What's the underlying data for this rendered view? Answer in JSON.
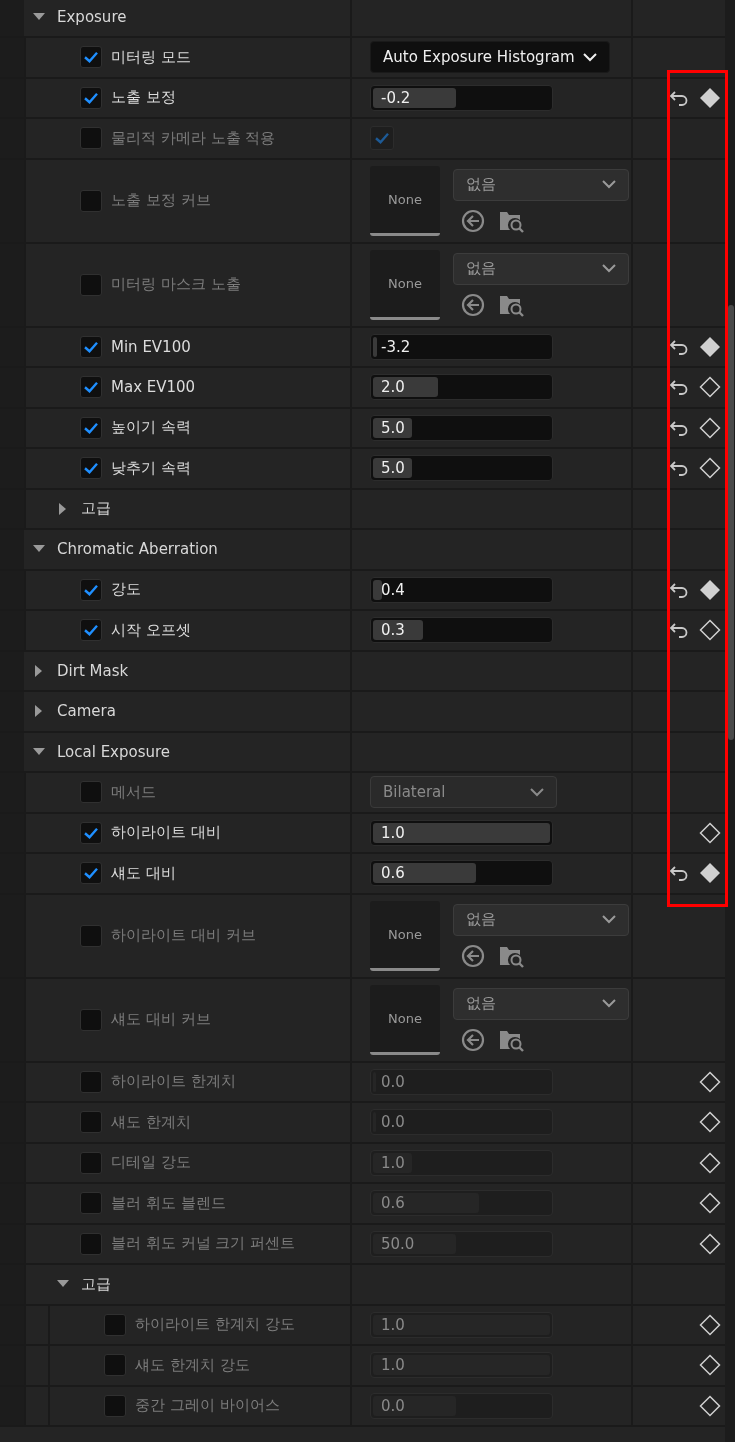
{
  "categories": [
    {
      "title": "Exposure",
      "expanded": true,
      "children": [
        {
          "kind": "property",
          "label": "미터링 모드",
          "checked": true,
          "reset": false,
          "animatable": false,
          "value": {
            "kind": "dropdown",
            "text": "Auto Exposure Histogram"
          }
        },
        {
          "kind": "property",
          "label": "노출 보정",
          "checked": true,
          "reset": true,
          "animatable": true,
          "keyed": true,
          "value": {
            "kind": "slider",
            "text": "-0.2",
            "level": 0.47
          }
        },
        {
          "kind": "property",
          "label": "물리적 카메라 노출 적용",
          "checked": false,
          "reset": false,
          "animatable": false,
          "value": {
            "kind": "checkbox",
            "checked": true
          }
        },
        {
          "kind": "property",
          "label": "노출 보정 커브",
          "checked": false,
          "reset": false,
          "animatable": false,
          "value": {
            "kind": "asset",
            "thumbnail": "None",
            "selection": "없음"
          }
        },
        {
          "kind": "property",
          "label": "미터링 마스크 노출",
          "checked": false,
          "reset": false,
          "animatable": false,
          "value": {
            "kind": "asset",
            "thumbnail": "None",
            "selection": "없음"
          }
        },
        {
          "kind": "property",
          "label": "Min EV100",
          "checked": true,
          "reset": true,
          "animatable": true,
          "keyed": true,
          "value": {
            "kind": "slider",
            "text": "-3.2",
            "level": 0.02
          }
        },
        {
          "kind": "property",
          "label": "Max EV100",
          "checked": true,
          "reset": true,
          "animatable": true,
          "keyed": false,
          "value": {
            "kind": "slider",
            "text": "2.0",
            "level": 0.37
          }
        },
        {
          "kind": "property",
          "label": "높이기 속력",
          "checked": true,
          "reset": true,
          "animatable": true,
          "keyed": false,
          "value": {
            "kind": "slider",
            "text": "5.0",
            "level": 0.22
          }
        },
        {
          "kind": "property",
          "label": "낮추기 속력",
          "checked": true,
          "reset": true,
          "animatable": true,
          "keyed": false,
          "value": {
            "kind": "slider",
            "text": "5.0",
            "level": 0.22
          }
        },
        {
          "kind": "group",
          "label": "고급",
          "expanded": false
        }
      ]
    },
    {
      "title": "Chromatic Aberration",
      "expanded": true,
      "children": [
        {
          "kind": "property",
          "label": "강도",
          "checked": true,
          "reset": true,
          "animatable": true,
          "keyed": true,
          "value": {
            "kind": "slider",
            "text": "0.4",
            "level": 0.05
          }
        },
        {
          "kind": "property",
          "label": "시작 오프셋",
          "checked": true,
          "reset": true,
          "animatable": true,
          "keyed": false,
          "value": {
            "kind": "slider",
            "text": "0.3",
            "level": 0.28
          }
        }
      ]
    },
    {
      "title": "Dirt Mask",
      "expanded": false
    },
    {
      "title": "Camera",
      "expanded": false
    },
    {
      "title": "Local Exposure",
      "expanded": true,
      "children": [
        {
          "kind": "property",
          "label": "메서드",
          "checked": false,
          "reset": false,
          "animatable": false,
          "value": {
            "kind": "dropdown",
            "text": "Bilateral"
          }
        },
        {
          "kind": "property",
          "label": "하이라이트 대비",
          "checked": true,
          "reset": false,
          "animatable": true,
          "keyed": false,
          "value": {
            "kind": "slider",
            "text": "1.0",
            "level": 1
          }
        },
        {
          "kind": "property",
          "label": "섀도 대비",
          "checked": true,
          "reset": true,
          "animatable": true,
          "keyed": true,
          "value": {
            "kind": "slider",
            "text": "0.6",
            "level": 0.58
          }
        },
        {
          "kind": "property",
          "label": "하이라이트 대비 커브",
          "checked": false,
          "reset": false,
          "animatable": false,
          "value": {
            "kind": "asset",
            "thumbnail": "None",
            "selection": "없음"
          }
        },
        {
          "kind": "property",
          "label": "섀도 대비 커브",
          "checked": false,
          "reset": false,
          "animatable": false,
          "value": {
            "kind": "asset",
            "thumbnail": "None",
            "selection": "없음"
          }
        },
        {
          "kind": "property",
          "label": "하이라이트 한계치",
          "checked": false,
          "reset": false,
          "animatable": true,
          "keyed": false,
          "value": {
            "kind": "slider",
            "text": "0.0",
            "level": 0
          }
        },
        {
          "kind": "property",
          "label": "섀도 한계치",
          "checked": false,
          "reset": false,
          "animatable": true,
          "keyed": false,
          "value": {
            "kind": "slider",
            "text": "0.0",
            "level": 0
          }
        },
        {
          "kind": "property",
          "label": "디테일 강도",
          "checked": false,
          "reset": false,
          "animatable": true,
          "keyed": false,
          "value": {
            "kind": "slider",
            "text": "1.0",
            "level": 0.22
          }
        },
        {
          "kind": "property",
          "label": "블러 휘도 블렌드",
          "checked": false,
          "reset": false,
          "animatable": true,
          "keyed": false,
          "value": {
            "kind": "slider",
            "text": "0.6",
            "level": 0.6
          }
        },
        {
          "kind": "property",
          "label": "블러 휘도 커널 크기 퍼센트",
          "checked": false,
          "reset": false,
          "animatable": true,
          "keyed": false,
          "value": {
            "kind": "slider",
            "text": "50.0",
            "level": 0.47
          }
        },
        {
          "kind": "group",
          "label": "고급",
          "expanded": true,
          "children": [
            {
              "kind": "property",
              "label": "하이라이트 한계치 강도",
              "checked": false,
              "reset": false,
              "animatable": true,
              "keyed": false,
              "value": {
                "kind": "slider",
                "text": "1.0",
                "level": 1
              }
            },
            {
              "kind": "property",
              "label": "섀도 한계치 강도",
              "checked": false,
              "reset": false,
              "animatable": true,
              "keyed": false,
              "value": {
                "kind": "slider",
                "text": "1.0",
                "level": 1
              }
            },
            {
              "kind": "property",
              "label": "중간 그레이 바이어스",
              "checked": false,
              "reset": false,
              "animatable": true,
              "keyed": false,
              "value": {
                "kind": "slider",
                "text": "0.0",
                "level": 0.47
              }
            }
          ]
        }
      ]
    }
  ]
}
